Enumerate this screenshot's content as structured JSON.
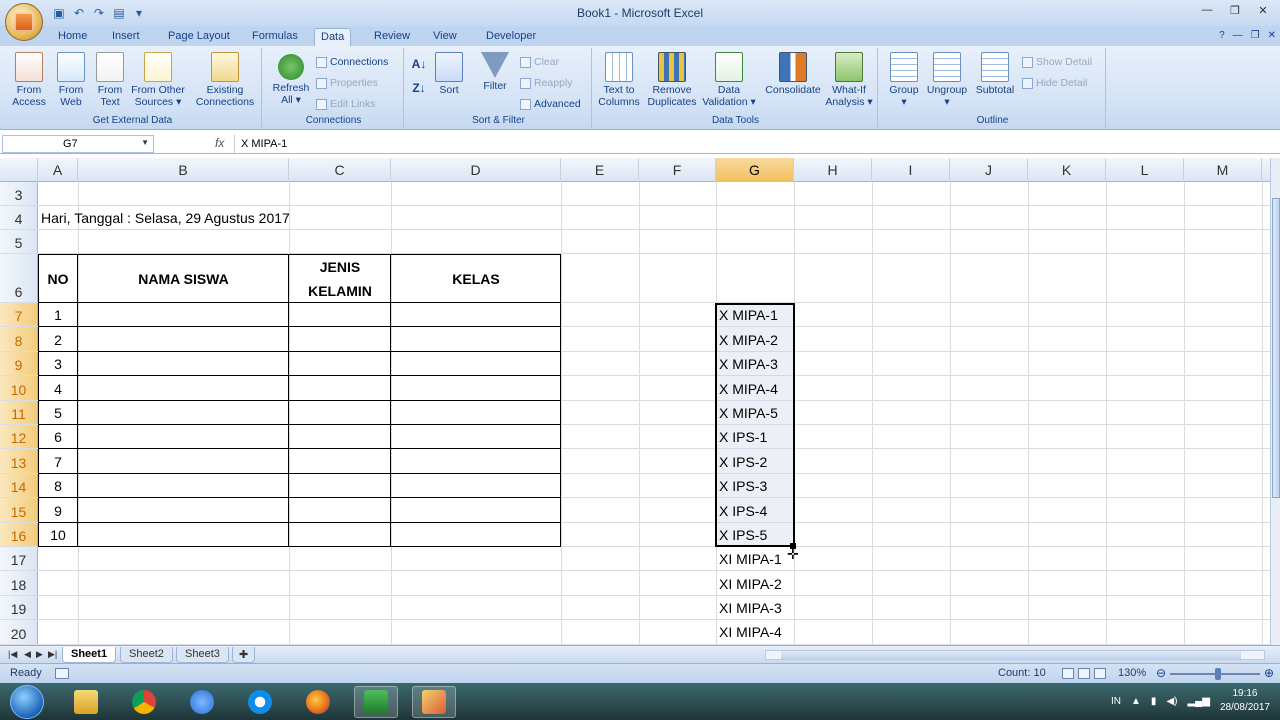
{
  "window": {
    "title": "Book1 - Microsoft Excel"
  },
  "tabs": [
    "Home",
    "Insert",
    "Page Layout",
    "Formulas",
    "Data",
    "Review",
    "View",
    "Developer"
  ],
  "active_tab": "Data",
  "ribbon": {
    "get_external_data": {
      "label": "Get External Data",
      "buttons": [
        {
          "l1": "From",
          "l2": "Access"
        },
        {
          "l1": "From",
          "l2": "Web"
        },
        {
          "l1": "From",
          "l2": "Text"
        },
        {
          "l1": "From Other",
          "l2": "Sources ▾"
        },
        {
          "l1": "Existing",
          "l2": "Connections"
        }
      ]
    },
    "connections": {
      "label": "Connections",
      "refresh": {
        "l1": "Refresh",
        "l2": "All ▾"
      },
      "items": [
        "Connections",
        "Properties",
        "Edit Links"
      ]
    },
    "sort_filter": {
      "label": "Sort & Filter",
      "sort": "Sort",
      "filter": "Filter",
      "items": [
        "Clear",
        "Reapply",
        "Advanced"
      ]
    },
    "data_tools": {
      "label": "Data Tools",
      "buttons": [
        {
          "l1": "Text to",
          "l2": "Columns"
        },
        {
          "l1": "Remove",
          "l2": "Duplicates"
        },
        {
          "l1": "Data",
          "l2": "Validation ▾"
        },
        {
          "l1": "Consolidate",
          "l2": ""
        },
        {
          "l1": "What-If",
          "l2": "Analysis ▾"
        }
      ]
    },
    "outline": {
      "label": "Outline",
      "buttons": [
        "Group",
        "Ungroup",
        "Subtotal"
      ],
      "items": [
        "Show Detail",
        "Hide Detail"
      ]
    }
  },
  "formula_bar": {
    "name_box": "G7",
    "fx": "fx",
    "formula": "X MIPA-1"
  },
  "columns": [
    "A",
    "B",
    "C",
    "D",
    "E",
    "F",
    "G",
    "H",
    "I",
    "J",
    "K",
    "L",
    "M"
  ],
  "rows": [
    "3",
    "4",
    "5",
    "6",
    "7",
    "8",
    "9",
    "10",
    "11",
    "12",
    "13",
    "14",
    "15",
    "16",
    "17",
    "18",
    "19",
    "20"
  ],
  "sheet": {
    "row4_text": "Hari, Tanggal : Selasa, 29 Agustus 2017",
    "headers": {
      "no": "NO",
      "nama": "NAMA SISWA",
      "jenis1": "JENIS",
      "jenis2": "KELAMIN",
      "kelas": "KELAS"
    },
    "numbers": [
      "1",
      "2",
      "3",
      "4",
      "5",
      "6",
      "7",
      "8",
      "9",
      "10"
    ],
    "col_g": [
      "X MIPA-1",
      "X MIPA-2",
      "X MIPA-3",
      "X MIPA-4",
      "X MIPA-5",
      "X IPS-1",
      "X IPS-2",
      "X IPS-3",
      "X IPS-4",
      "X IPS-5",
      "XI MIPA-1",
      "XI MIPA-2",
      "XI MIPA-3",
      "XI MIPA-4"
    ]
  },
  "sheet_tabs": [
    "Sheet1",
    "Sheet2",
    "Sheet3"
  ],
  "status": {
    "ready": "Ready",
    "count": "Count: 10",
    "zoom": "130%"
  },
  "taskbar": {
    "lang": "IN",
    "time": "19:16",
    "date": "28/08/2017"
  }
}
